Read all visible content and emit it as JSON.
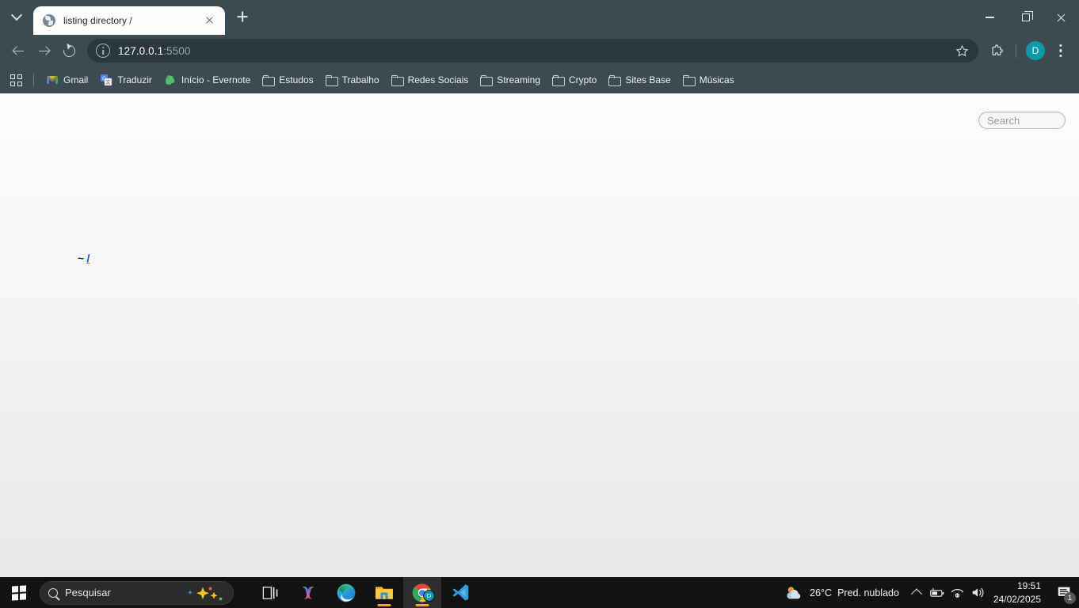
{
  "window": {
    "controls": {
      "minimize": "Minimize",
      "maximize": "Restore",
      "close": "Close"
    }
  },
  "browser": {
    "tab_search_label": "Search tabs",
    "tabs": [
      {
        "title": "listing directory /",
        "favicon": "globe-icon",
        "active": true,
        "close_label": "Close tab"
      }
    ],
    "new_tab_label": "New Tab",
    "toolbar": {
      "back_label": "Back",
      "forward_label": "Forward",
      "reload_label": "Reload",
      "site_info_label": "View site information",
      "url_host": "127.0.0.1",
      "url_port": ":5500",
      "bookmark_label": "Bookmark this tab",
      "extensions_label": "Extensions",
      "profile_initial": "D",
      "menu_label": "Customize and control Google Chrome"
    },
    "bookmarks": {
      "apps_label": "All Bookmarks",
      "items": [
        {
          "label": "Gmail",
          "icon": "gmail-icon"
        },
        {
          "label": "Traduzir",
          "icon": "google-translate-icon"
        },
        {
          "label": "Início - Evernote",
          "icon": "evernote-icon"
        },
        {
          "label": "Estudos",
          "icon": "folder-icon"
        },
        {
          "label": "Trabalho",
          "icon": "folder-icon"
        },
        {
          "label": "Redes Sociais",
          "icon": "folder-icon"
        },
        {
          "label": "Streaming",
          "icon": "folder-icon"
        },
        {
          "label": "Crypto",
          "icon": "folder-icon"
        },
        {
          "label": "Sites Base",
          "icon": "folder-icon"
        },
        {
          "label": "Músicas",
          "icon": "folder-icon"
        }
      ]
    }
  },
  "page": {
    "search": {
      "placeholder": "Search",
      "value": ""
    },
    "directory": {
      "prefix": "~",
      "path": "/"
    }
  },
  "taskbar": {
    "start_label": "Start",
    "search": {
      "placeholder": "Pesquisar",
      "icon": "search-icon"
    },
    "apps": [
      {
        "name": "task-view",
        "label": "Task View",
        "running": false,
        "active": false
      },
      {
        "name": "copilot",
        "label": "Copilot",
        "running": false,
        "active": false
      },
      {
        "name": "edge",
        "label": "Microsoft Edge",
        "running": false,
        "active": false
      },
      {
        "name": "file-explorer",
        "label": "File Explorer",
        "running": true,
        "active": false
      },
      {
        "name": "chrome",
        "label": "Google Chrome",
        "running": true,
        "active": true
      },
      {
        "name": "vscode",
        "label": "Visual Studio Code",
        "running": false,
        "active": false
      }
    ],
    "tray": {
      "weather_temp": "26°C",
      "weather_desc": "Pred. nublado",
      "show_hidden_label": "Show hidden icons",
      "battery_label": "Battery",
      "network_label": "Network",
      "volume_label": "Volume",
      "time": "19:51",
      "date": "24/02/2025",
      "notifications_count": "1"
    }
  },
  "colors": {
    "chrome_frame": "#3c4a52",
    "omnibox": "#2b373e",
    "accent_profile": "#0d9aa8",
    "taskbar": "#121212",
    "running_indicator": "#f2a51a",
    "link": "#0b55c4"
  }
}
